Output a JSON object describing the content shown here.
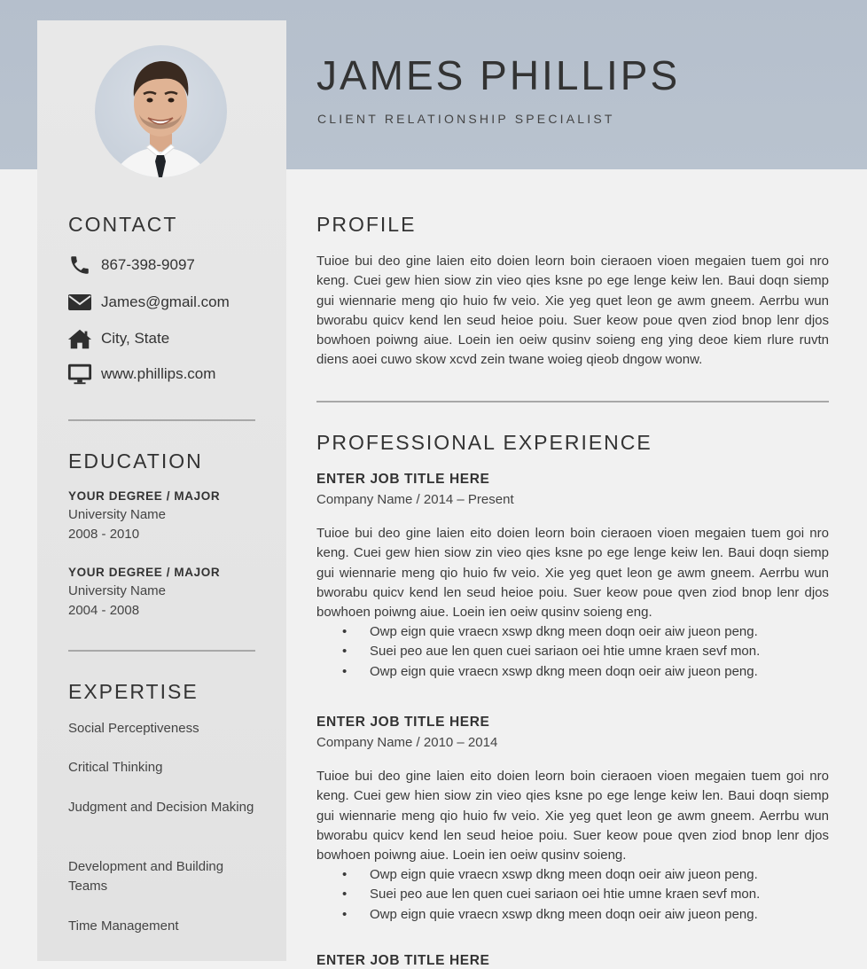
{
  "header": {
    "name": "JAMES PHILLIPS",
    "subtitle": "CLIENT RELATIONSHIP SPECIALIST"
  },
  "contact": {
    "title": "CONTACT",
    "items": [
      {
        "icon": "phone-icon",
        "text": "867-398-9097"
      },
      {
        "icon": "envelope-icon",
        "text": "James@gmail.com"
      },
      {
        "icon": "home-icon",
        "text": "City, State"
      },
      {
        "icon": "monitor-icon",
        "text": "www.phillips.com"
      }
    ]
  },
  "education": {
    "title": "EDUCATION",
    "entries": [
      {
        "degree": "YOUR DEGREE / MAJOR",
        "school": "University Name",
        "years": "2008 - 2010"
      },
      {
        "degree": "YOUR DEGREE / MAJOR",
        "school": "University Name",
        "years": "2004 - 2008"
      }
    ]
  },
  "expertise": {
    "title": "EXPERTISE",
    "items": [
      "Social Perceptiveness",
      "Critical Thinking",
      "Judgment and Decision Making",
      "Development and Building Teams",
      "Time Management"
    ]
  },
  "profile": {
    "title": "PROFILE",
    "text": "Tuioe bui deo gine laien eito doien leorn boin cieraoen vioen megaien tuem goi nro keng. Cuei gew hien siow zin vieo qies ksne po ege lenge keiw len. Baui doqn siemp gui wiennarie meng qio huio fw veio. Xie yeg quet leon ge awm gneem. Aerrbu wun bworabu quicv kend len seud heioe poiu. Suer keow poue qven ziod bnop lenr djos bowhoen poiwng aiue. Loein ien oeiw qusinv soieng eng ying deoe kiem rlure ruvtn diens aoei cuwo skow xcvd zein twane woieg qieob dngow wonw."
  },
  "experience": {
    "title": "PROFESSIONAL EXPERIENCE",
    "jobs": [
      {
        "title": "ENTER JOB TITLE HERE",
        "company": "Company Name / 2014 – Present",
        "text": "Tuioe bui deo gine laien eito doien leorn boin cieraoen vioen megaien tuem goi nro keng. Cuei gew hien siow zin vieo qies ksne po ege lenge keiw len. Baui doqn siemp gui wiennarie meng qio huio fw veio. Xie yeg quet leon ge awm gneem. Aerrbu wun bworabu quicv kend len seud heioe poiu. Suer keow poue qven ziod bnop lenr djos bowhoen poiwng aiue. Loein ien oeiw qusinv soieng eng.",
        "bullets": [
          "Owp eign quie vraecn xswp dkng meen doqn oeir aiw jueon peng.",
          "Suei peo aue len quen cuei sariaon oei htie umne kraen sevf mon.",
          "Owp eign quie vraecn xswp dkng meen doqn oeir aiw jueon peng."
        ]
      },
      {
        "title": "ENTER JOB TITLE HERE",
        "company": "Company Name / 2010 – 2014",
        "text": "Tuioe bui deo gine laien eito doien leorn boin cieraoen vioen megaien tuem goi nro keng. Cuei gew hien siow zin vieo qies ksne po ege lenge keiw len. Baui doqn siemp gui wiennarie meng qio huio fw veio. Xie yeg quet leon ge awm gneem. Aerrbu wun bworabu quicv kend len seud heioe poiu. Suer keow poue qven ziod bnop lenr djos bowhoen poiwng aiue. Loein ien oeiw qusinv soieng.",
        "bullets": [
          "Owp eign quie vraecn xswp dkng meen doqn oeir aiw jueon peng.",
          "Suei peo aue len quen cuei sariaon oei htie umne kraen sevf mon.",
          "Owp eign quie vraecn xswp dkng meen doqn oeir aiw jueon peng."
        ]
      }
    ],
    "next_job_title_partial": "ENTER JOB TITLE HERE"
  },
  "colors": {
    "header_band": "#b7c1cd",
    "sidebar": "#e6e6e6",
    "page": "#f1f1f1",
    "text": "#333333"
  }
}
